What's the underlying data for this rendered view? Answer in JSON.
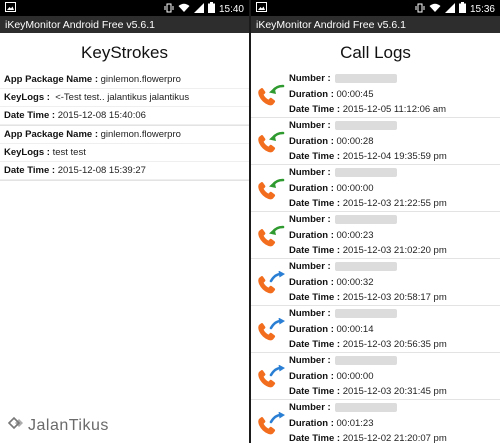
{
  "left": {
    "status_time": "15:40",
    "app_title": "iKeyMonitor Android Free v5.6.1",
    "screen_title": "KeyStrokes",
    "label_package": "App Package Name :",
    "label_keylogs": "KeyLogs :",
    "label_datetime": "Date Time :",
    "entries": [
      {
        "package": "ginlemon.flowerpro",
        "keylogs": "<-Test test.. jalantikus jalantikus",
        "datetime": "2015-12-08 15:40:06"
      },
      {
        "package": "ginlemon.flowerpro",
        "keylogs": "test test",
        "datetime": "2015-12-08 15:39:27"
      }
    ]
  },
  "right": {
    "status_time": "15:36",
    "app_title": "iKeyMonitor Android Free v5.6.1",
    "screen_title": "Call Logs",
    "label_number": "Number :",
    "label_duration": "Duration :",
    "label_datetime": "Date Time :",
    "calls": [
      {
        "direction": "incoming",
        "duration": "00:00:45",
        "datetime": "2015-12-05 11:12:06 am"
      },
      {
        "direction": "incoming",
        "duration": "00:00:28",
        "datetime": "2015-12-04 19:35:59 pm"
      },
      {
        "direction": "incoming",
        "duration": "00:00:00",
        "datetime": "2015-12-03 21:22:55 pm"
      },
      {
        "direction": "incoming",
        "duration": "00:00:23",
        "datetime": "2015-12-03 21:02:20 pm"
      },
      {
        "direction": "outgoing",
        "duration": "00:00:32",
        "datetime": "2015-12-03 20:58:17 pm"
      },
      {
        "direction": "outgoing",
        "duration": "00:00:14",
        "datetime": "2015-12-03 20:56:35 pm"
      },
      {
        "direction": "outgoing",
        "duration": "00:00:00",
        "datetime": "2015-12-03 20:31:45 pm"
      },
      {
        "direction": "outgoing",
        "duration": "00:01:23",
        "datetime": "2015-12-02 21:20:07 pm"
      }
    ]
  },
  "watermark": {
    "text": "JalanTikus"
  },
  "colors": {
    "handset": "#f26d1e",
    "incoming_arrow": "#2f9a2f",
    "outgoing_arrow": "#2a7fd4",
    "statusbar": "#000000",
    "appbar": "#2d2d2d"
  },
  "icons": {
    "status_left": "image-icon",
    "status_right": [
      "vibrate-icon",
      "wifi-icon",
      "signal-icon",
      "battery-icon"
    ]
  }
}
